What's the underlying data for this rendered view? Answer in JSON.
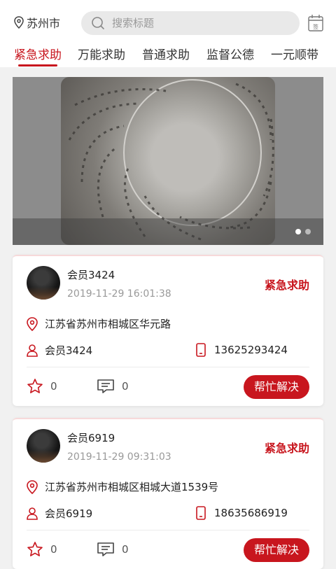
{
  "header": {
    "location": "苏州市",
    "search_placeholder": "搜索标题",
    "calendar_label": "签"
  },
  "tabs": [
    {
      "label": "紧急求助",
      "active": true
    },
    {
      "label": "万能求助",
      "active": false
    },
    {
      "label": "普通求助",
      "active": false
    },
    {
      "label": "监督公德",
      "active": false
    },
    {
      "label": "一元顺带",
      "active": false
    }
  ],
  "banner": {
    "slide_count": 2,
    "active_slide": 1
  },
  "posts": [
    {
      "name": "会员3424",
      "time": "2019-11-29 16:01:38",
      "tag": "紧急求助",
      "address": "江苏省苏州市相城区华元路",
      "contact": "会员3424",
      "phone": "13625293424",
      "likes": "0",
      "comments": "0",
      "action": "帮忙解决"
    },
    {
      "name": "会员6919",
      "time": "2019-11-29 09:31:03",
      "tag": "紧急求助",
      "address": "江苏省苏州市相城区相城大道1539号",
      "contact": "会员6919",
      "phone": "18635686919",
      "likes": "0",
      "comments": "0",
      "action": "帮忙解决"
    }
  ],
  "colors": {
    "accent": "#c8161e",
    "background": "#f1f1f1"
  }
}
